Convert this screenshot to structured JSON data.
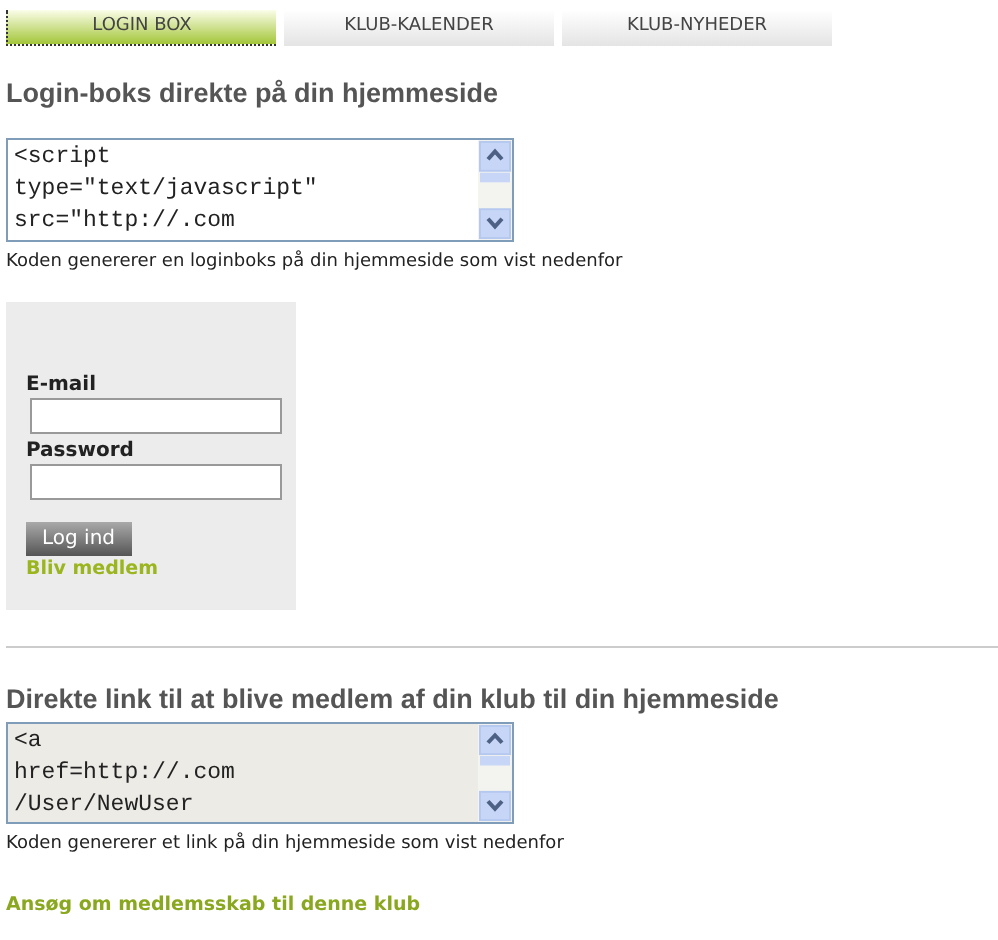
{
  "tabs": [
    {
      "label": "LOGIN BOX",
      "selected": true
    },
    {
      "label": "KLUB-KALENDER",
      "selected": false
    },
    {
      "label": "KLUB-NYHEDER",
      "selected": false
    }
  ],
  "login_section": {
    "heading": "Login-boks direkte på din hjemmeside",
    "code_lines": [
      "<script",
      "type=\"text/javascript\"",
      "src=\"http://.com"
    ],
    "caption": "Koden genererer en loginboks på din hjemmeside som vist nedenfor"
  },
  "login_preview": {
    "email_label": "E-mail",
    "password_label": "Password",
    "button": "Log ind",
    "join_link": "Bliv medlem"
  },
  "link_section": {
    "heading": "Direkte link til at blive medlem af din klub til din hjemmeside",
    "code_lines": [
      "<a",
      "href=http://.com",
      "/User/NewUser"
    ],
    "caption": "Koden genererer et link på din hjemmeside som vist nedenfor",
    "link": "Ansøg om medlemsskab til denne klub"
  }
}
